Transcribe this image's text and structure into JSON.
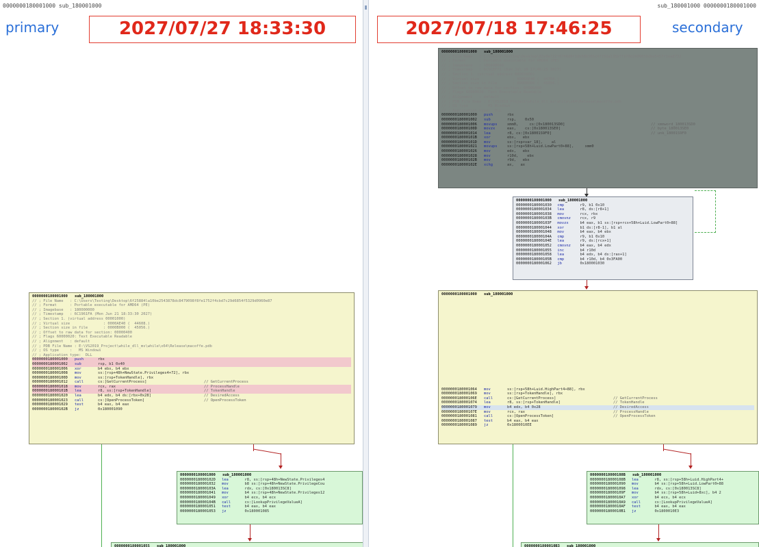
{
  "left": {
    "header": "0000000180001000 sub_180001000",
    "brand": "primary",
    "timestamp": "2027/07/27 18:33:30",
    "main_block": {
      "title_addr": "0000000180001000",
      "title_name": "sub_180001000",
      "comments": [
        "// ; File Name   : C:\\Users\\Testing\\Desktop\\6f25884la10be2543878dc8479098f8fe1752f4cbd7c29d6854f5329d0960e87",
        "// ; Format      : Portable executable for AMD64 (PE)",
        "// ; Imagebase   : 180000000",
        "// ; Timestamp   : 6C1961FA (Mon Jun 21 18:33:30 2027)",
        "// ; Section 1. (virtual address 00001000)",
        "// ; Virtual size               : 0000AE40 (  44608.)",
        "// ; Section size in file       : 0000B000 (  45056.)",
        "// ; Offset to raw data for section: 00000400",
        "// ; Flags 60000020: Text Executable Readable",
        "// ; Alignment   : default",
        "// ; PDB File Name : E:\\VS2019_Project\\while_dll_ms\\while\\x64\\Release\\macoffe.pdb",
        "// ; OS type     :   MS Windows",
        "// ; Application type:  DLL"
      ],
      "lines": [
        {
          "a": "0000000180001000",
          "m": "push",
          "o": "rbx",
          "c": "",
          "h": "pink"
        },
        {
          "a": "0000000180001002",
          "m": "sub",
          "o": "rsp, b1 0x40",
          "c": "",
          "h": "pink"
        },
        {
          "a": "0000000180001006",
          "m": "xor",
          "o": "b4 ebx, b4 ebx",
          "c": "",
          "h": ""
        },
        {
          "a": "0000000180001008",
          "m": "mov",
          "o": "ss:[rsp+48h+NewState.Privileges4+72], rbx",
          "c": "",
          "h": ""
        },
        {
          "a": "000000018000100D",
          "m": "mov",
          "o": "ss:[rsp+TokenHandle], rbx",
          "c": "",
          "h": ""
        },
        {
          "a": "0000000180001012",
          "m": "call",
          "o": "cs:[GetCurrentProcess]",
          "c": "// GetCurrentProcess",
          "h": ""
        },
        {
          "a": "0000000180001018",
          "m": "mov",
          "o": "rcx, rax",
          "c": "// ProcessHandle",
          "h": "pink"
        },
        {
          "a": "000000018000101B",
          "m": "lea",
          "o": "r8, ss:[rsp+TokenHandle]",
          "c": "// TokenHandle",
          "h": "pink"
        },
        {
          "a": "0000000180001020",
          "m": "lea",
          "o": "b4 edx, b4 ds:[rbx+0x28]",
          "c": "// DesiredAccess",
          "h": ""
        },
        {
          "a": "",
          "m": "",
          "o": "",
          "c": "",
          "h": ""
        },
        {
          "a": "0000000180001023",
          "m": "call",
          "o": "cs:[OpenProcessToken]",
          "c": "// OpenProcessToken",
          "h": ""
        },
        {
          "a": "0000000180001029",
          "m": "test",
          "o": "b4 eax, b4 eax",
          "c": "",
          "h": ""
        },
        {
          "a": "000000018000102B",
          "m": "jz",
          "o": "0x180001090",
          "c": "",
          "h": ""
        }
      ]
    },
    "green_block": {
      "title_addr": "0000000180001000",
      "title_name": "sub_180001000",
      "lines": [
        {
          "a": "000000018000102D",
          "m": "lea",
          "o": "r8, ss:[rsp+48h+NewState.Privileges4"
        },
        {
          "a": "0000000180001032",
          "m": "mov",
          "o": "b8 ss:[rsp+48h+NewState.PrivilegeCou"
        },
        {
          "a": "000000018000103A",
          "m": "lea",
          "o": "rdx, cs:[0x180013SC8]"
        },
        {
          "a": "0000000180001041",
          "m": "mov",
          "o": "b4 ss:[rsp+48h+NewState.Privileges12"
        },
        {
          "a": "0000000180001049",
          "m": "xor",
          "o": "b4 ecx, b4 ecx"
        },
        {
          "a": "000000018000104B",
          "m": "call",
          "o": "cs:[LookupPrivilegeValueA]"
        },
        {
          "a": "0000000180001051",
          "m": "test",
          "o": "b4 eax, b4 eax"
        },
        {
          "a": "0000000180001053",
          "m": "jz",
          "o": "0x180001085"
        }
      ]
    },
    "bottom_block": {
      "title_addr": "0000000180001055",
      "title_name": "sub_180001000"
    }
  },
  "right": {
    "header": "sub_180001000 0000000180001000",
    "brand": "secondary",
    "timestamp": "2027/07/18 17:46:25",
    "grey_block": {
      "title_addr": "0000000180001000",
      "title_name": "sub_180001000",
      "comments": [
        "// ; File Name   : C:\\Users\\Testing\\Desktop\\82a0e722f6748d6f1db58b565c4f15da135bff170d2000056dbe5457f1ea8732",
        "// ; Format      : Portable executable for AMD64 (PE)",
        "// ; Imagebase   : 180000000",
        "// ; Timestamp   : 6C5CEF71 (Sun Jul 18 17:46:25 2027)",
        "// ; Section 1. (virtual address 00001000)",
        "// ; Virtual size               : 0000AE40 (  44704.)",
        "// ; Section size in file       : 0000B000 (  45056.)",
        "// ; Offset to raw data for section: 00000400",
        "// ; Flags 60000020: Text Executable Readable",
        "// ; Alignment   : default",
        "// ; PDB File Name : E:\\VS2019_Project\\while_dll_ms\\while\\x64\\Release\\macoffe.pdb",
        "// ; OS type     :   MS Windows",
        "// ; Application type:  DLL"
      ],
      "lines": [
        {
          "a": "0000000180001000",
          "m": "push",
          "o": "rbx",
          "c": ""
        },
        {
          "a": "0000000180001002",
          "m": "sub",
          "o": "rsp,    0x50",
          "c": ""
        },
        {
          "a": "0000000180001006",
          "m": "movups",
          "o": "xmm0,     cs:[0x180013SD0]",
          "c": "// xmmword_180013SD0"
        },
        {
          "a": "000000018000100D",
          "m": "movzx",
          "o": "eax,    cs:[0x180013SE0]",
          "c": "// byte_180013SE0"
        },
        {
          "a": "0000000180001014",
          "m": "lea",
          "o": "r8, cs:[0x18001S9F0]",
          "c": "// unk_18001S9F0"
        },
        {
          "a": "000000018000101B",
          "m": "xor",
          "o": "ebx,   ebx",
          "c": ""
        },
        {
          "a": "000000018000101D",
          "m": "mov",
          "o": "ss:[rsp+var_18],    al",
          "c": ""
        },
        {
          "a": "0000000180001021",
          "m": "movups",
          "o": "ss:[rsp+58h+Luid.LowPart0+88],     xmm0",
          "c": ""
        },
        {
          "a": "0000000180001026",
          "m": "mov",
          "o": "edx,   ebx",
          "c": ""
        },
        {
          "a": "0000000180001028",
          "m": "mov",
          "o": "r10d,    ebx",
          "c": ""
        },
        {
          "a": "000000018000102B",
          "m": "mov",
          "o": "r9d,   ebx",
          "c": ""
        },
        {
          "a": "000000018000102E",
          "m": "xchg",
          "o": "ax,   ax",
          "c": ""
        }
      ]
    },
    "loop_block": {
      "title_addr": "0000000180001000",
      "title_name": "sub_180001000",
      "lines": [
        {
          "a": "0000000180001030",
          "m": "cmp",
          "o": "r9, b1 0x10"
        },
        {
          "a": "0000000180001034",
          "m": "lea",
          "o": "r8, ds:[r8+1]"
        },
        {
          "a": "0000000180001038",
          "m": "mov",
          "o": "rcx, rbx"
        },
        {
          "a": "000000018000103B",
          "m": "cmovnz",
          "o": "rcx, r9"
        },
        {
          "a": "000000018000103F",
          "m": "movzx",
          "o": "b4 eax, b1 ss:[rsp+rcx+58h+Luid.LowPart0+88]"
        },
        {
          "a": "0000000180001044",
          "m": "xor",
          "o": "b1 ds:[r8-1], b1 al"
        },
        {
          "a": "0000000180001048",
          "m": "mov",
          "o": "b4 eax, b4 ebx"
        },
        {
          "a": "000000018000104A",
          "m": "cmp",
          "o": "r9, b1 0x10"
        },
        {
          "a": "000000018000104E",
          "m": "lea",
          "o": "r9, ds:[rcx+1]"
        },
        {
          "a": "0000000180001052",
          "m": "cmovnz",
          "o": "b4 eax, b4 edx"
        },
        {
          "a": "0000000180001055",
          "m": "inc",
          "o": "b4 r10d"
        },
        {
          "a": "0000000180001058",
          "m": "lea",
          "o": "b4 edx, b4 ds:[rax+1]"
        },
        {
          "a": "000000018000105B",
          "m": "cmp",
          "o": "b4 r10d, b4 0x3FA00"
        },
        {
          "a": "0000000180001062",
          "m": "jb",
          "o": "0x180001030"
        }
      ]
    },
    "main_block": {
      "title_addr": "0000000180001000",
      "title_name": "sub_180001000",
      "lines": [
        {
          "a": "0000000180001064",
          "m": "mov",
          "o": "ss:[rsp+58h+Luid.HighPart4+88], rbx",
          "c": "",
          "h": ""
        },
        {
          "a": "0000000180001069",
          "m": "mov",
          "o": "ss:[rsp+TokenHandle], rbx",
          "c": "",
          "h": ""
        },
        {
          "a": "000000018000106E",
          "m": "call",
          "o": "cs:[GetCurrentProcess]",
          "c": "// GetCurrentProcess",
          "h": ""
        },
        {
          "a": "",
          "m": "",
          "o": "",
          "c": "",
          "h": ""
        },
        {
          "a": "0000000180001074",
          "m": "lea",
          "o": "r8, ss:[rsp+TokenHandle]",
          "c": "// TokenHandle",
          "h": ""
        },
        {
          "a": "0000000180001079",
          "m": "mov",
          "o": "b4 edx, b4 0x28",
          "c": "// DesiredAccess",
          "h": "blue"
        },
        {
          "a": "000000018000107E",
          "m": "mov",
          "o": "rcx, rax",
          "c": "// ProcessHandle",
          "h": ""
        },
        {
          "a": "0000000180001081",
          "m": "call",
          "o": "cs:[OpenProcessToken]",
          "c": "// OpenProcessToken",
          "h": ""
        },
        {
          "a": "0000000180001087",
          "m": "test",
          "o": "b4 eax, b4 eax",
          "c": "",
          "h": ""
        },
        {
          "a": "0000000180001089",
          "m": "jz",
          "o": "0x1800010EE",
          "c": "",
          "h": ""
        }
      ]
    },
    "green_block": {
      "title_addr": "000000018000108B",
      "title_name": "sub_180001000",
      "lines": [
        {
          "a": "000000018000108B",
          "m": "lea",
          "o": "r8, ss:[rsp+58h+Luid.HighPart4+"
        },
        {
          "a": "0000000180001090",
          "m": "mov",
          "o": "b4 ss:[rsp+58h+Luid.LowPart0+88"
        },
        {
          "a": "0000000180001098",
          "m": "lea",
          "o": "rdx, cs:[0x180013SC8]"
        },
        {
          "a": "000000018000109F",
          "m": "mov",
          "o": "b4 ss:[rsp+58h+Luid+8xc], b4 2"
        },
        {
          "a": "00000001800010A7",
          "m": "xor",
          "o": "b4 ecx, b4 ecx"
        },
        {
          "a": "00000001800010A9",
          "m": "call",
          "o": "cs:[LookupPrivilegeValueA]"
        },
        {
          "a": "00000001800010AF",
          "m": "test",
          "o": "b4 eax, b4 eax"
        },
        {
          "a": "00000001800010B1",
          "m": "jz",
          "o": "0x1800010E3"
        }
      ]
    },
    "bottom_block": {
      "title_addr": "00000001800010B3",
      "title_name": "sub_180001000"
    }
  }
}
